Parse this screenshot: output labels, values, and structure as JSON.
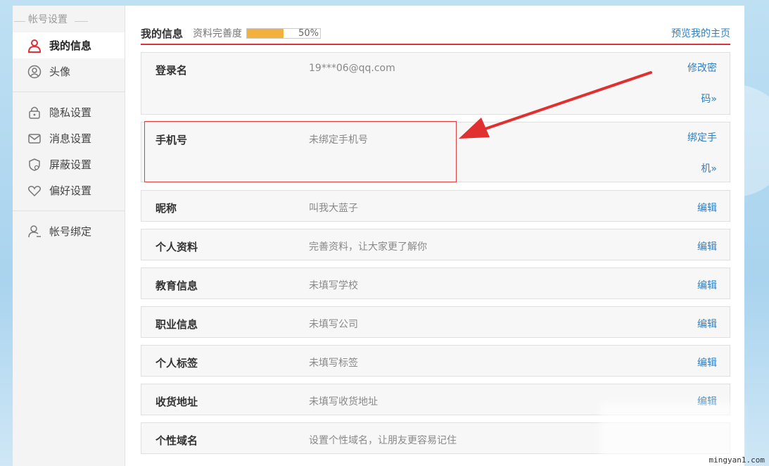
{
  "sidebar": {
    "heading": "帐号设置",
    "items": [
      {
        "label": "我的信息",
        "icon": "user-icon",
        "active": true
      },
      {
        "label": "头像",
        "icon": "avatar-icon",
        "active": false
      },
      {
        "label": "隐私设置",
        "icon": "lock-icon",
        "active": false
      },
      {
        "label": "消息设置",
        "icon": "message-icon",
        "active": false
      },
      {
        "label": "屏蔽设置",
        "icon": "shield-icon",
        "active": false
      },
      {
        "label": "偏好设置",
        "icon": "heart-icon",
        "active": false
      },
      {
        "label": "帐号绑定",
        "icon": "user-bind-icon",
        "active": false
      }
    ]
  },
  "header": {
    "title": "我的信息",
    "completeness_label": "资料完善度",
    "completeness_value": 0.5,
    "completeness_text": "50%",
    "preview_link": "预览我的主页"
  },
  "rows": [
    {
      "label": "登录名",
      "value": "19***06@qq.com",
      "action": "修改密码»"
    },
    {
      "label": "手机号",
      "value": "未绑定手机号",
      "action": "绑定手机»"
    },
    {
      "label": "昵称",
      "value": "叫我大蓝子",
      "action": "编辑"
    },
    {
      "label": "个人资料",
      "value": "完善资料，让大家更了解你",
      "action": "编辑"
    },
    {
      "label": "教育信息",
      "value": "未填写学校",
      "action": "编辑"
    },
    {
      "label": "职业信息",
      "value": "未填写公司",
      "action": "编辑"
    },
    {
      "label": "个人标签",
      "value": "未填写标签",
      "action": "编辑"
    },
    {
      "label": "收货地址",
      "value": "未填写收货地址",
      "action": "编辑"
    },
    {
      "label": "个性域名",
      "value": "设置个性域名，让朋友更容易记住",
      "action": ""
    }
  ],
  "watermark": "mingyan1.com",
  "colors": {
    "accent_red": "#d8343c",
    "link_blue": "#2f7fc1",
    "progress_orange": "#f2b03c"
  }
}
